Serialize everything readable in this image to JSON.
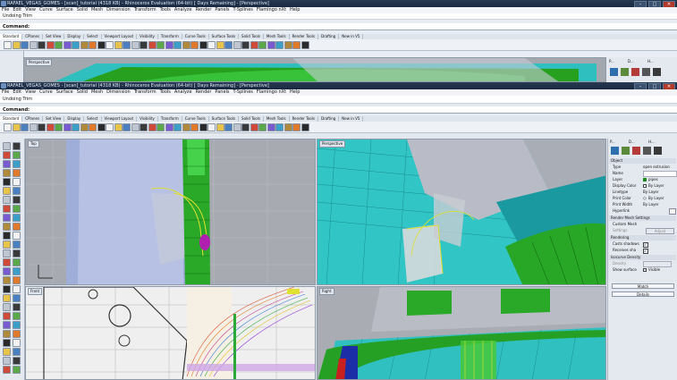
{
  "window_top": {
    "title": "RAFAEL_VEGAS_GOMES - [scan]_tutorial (4318 KB) - Rhinoceros Evaluation (64-bit) [ Days Remaining] - [Perspective]",
    "history": "Undoing Trim",
    "command": "Command:",
    "viewport_label": "Perspective"
  },
  "window_main": {
    "title": "RAFAEL_VEGAS_GOMES - [scan]_tutorial (4318 KB) - Rhinoceros Evaluation (64-bit) [ Days Remaining] - [Perspective]",
    "history": "Undoing Trim",
    "command": "Command:",
    "viewports": {
      "top": "Top",
      "perspective": "Perspective",
      "front": "Front",
      "right": "Right"
    }
  },
  "menu": [
    "File",
    "Edit",
    "View",
    "Curve",
    "Surface",
    "Solid",
    "Mesh",
    "Dimension",
    "Transform",
    "Tools",
    "Analyze",
    "Render",
    "Panels",
    "T-Splines",
    "Flamingo nXt",
    "Help"
  ],
  "toolbar_tabs": [
    "Standard",
    "CPlanes",
    "Set View",
    "Display",
    "Select",
    "Viewport Layout",
    "Visibility",
    "Transform",
    "Curve Tools",
    "Surface Tools",
    "Solid Tools",
    "Mesh Tools",
    "Render Tools",
    "Drafting",
    "New in V5"
  ],
  "panel_tabs": [
    "P...",
    "D...",
    "H..."
  ],
  "properties": {
    "section_object": "Object",
    "rows": [
      {
        "k": "Type",
        "v": "open extrusion"
      },
      {
        "k": "Name",
        "v": ""
      },
      {
        "k": "Layer",
        "v": "pipes"
      },
      {
        "k": "Display Color",
        "v": "By Layer"
      },
      {
        "k": "Linetype",
        "v": "By Layer"
      },
      {
        "k": "Print Color",
        "v": "By Layer"
      },
      {
        "k": "Print Width",
        "v": "By Layer"
      },
      {
        "k": "Hyperlink",
        "v": ""
      }
    ],
    "render_mesh": "Render Mesh Settings",
    "custom_mesh": "Custom Mesh",
    "settings": "Settings",
    "adjust": "Adjust",
    "rendering": "Rendering",
    "casts_shadows": "Casts shadows",
    "receives_shadows": "Receives sha",
    "isocurve": "Isocurve Density",
    "density": "Density",
    "show_surface": "Show surface",
    "visible": "Visible",
    "match": "Match",
    "details": "Details"
  },
  "colors": {
    "layer_swatch": "#1a8a1a",
    "accent": "#2a4a6e"
  }
}
